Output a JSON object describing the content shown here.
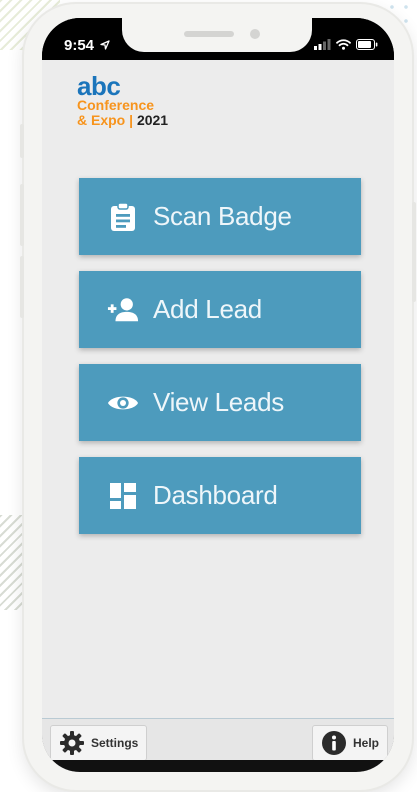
{
  "status_bar": {
    "time": "9:54",
    "location_icon": "location-arrow-icon",
    "signal_icon": "signal-bars-icon",
    "wifi_icon": "wifi-icon",
    "battery_icon": "battery-icon"
  },
  "logo": {
    "line1": "abc",
    "line2": "Conference",
    "line3_a": "& Expo",
    "line3_sep": "|",
    "line3_b": "2021"
  },
  "menu": {
    "items": [
      {
        "label": "Scan Badge",
        "icon": "clipboard-icon"
      },
      {
        "label": "Add Lead",
        "icon": "add-person-icon"
      },
      {
        "label": "View Leads",
        "icon": "eye-icon"
      },
      {
        "label": "Dashboard",
        "icon": "dashboard-icon"
      }
    ]
  },
  "footer": {
    "settings_label": "Settings",
    "help_label": "Help"
  },
  "colors": {
    "button": "#4d9bbd",
    "brand_blue": "#1b75bb",
    "brand_orange": "#f7941d"
  }
}
